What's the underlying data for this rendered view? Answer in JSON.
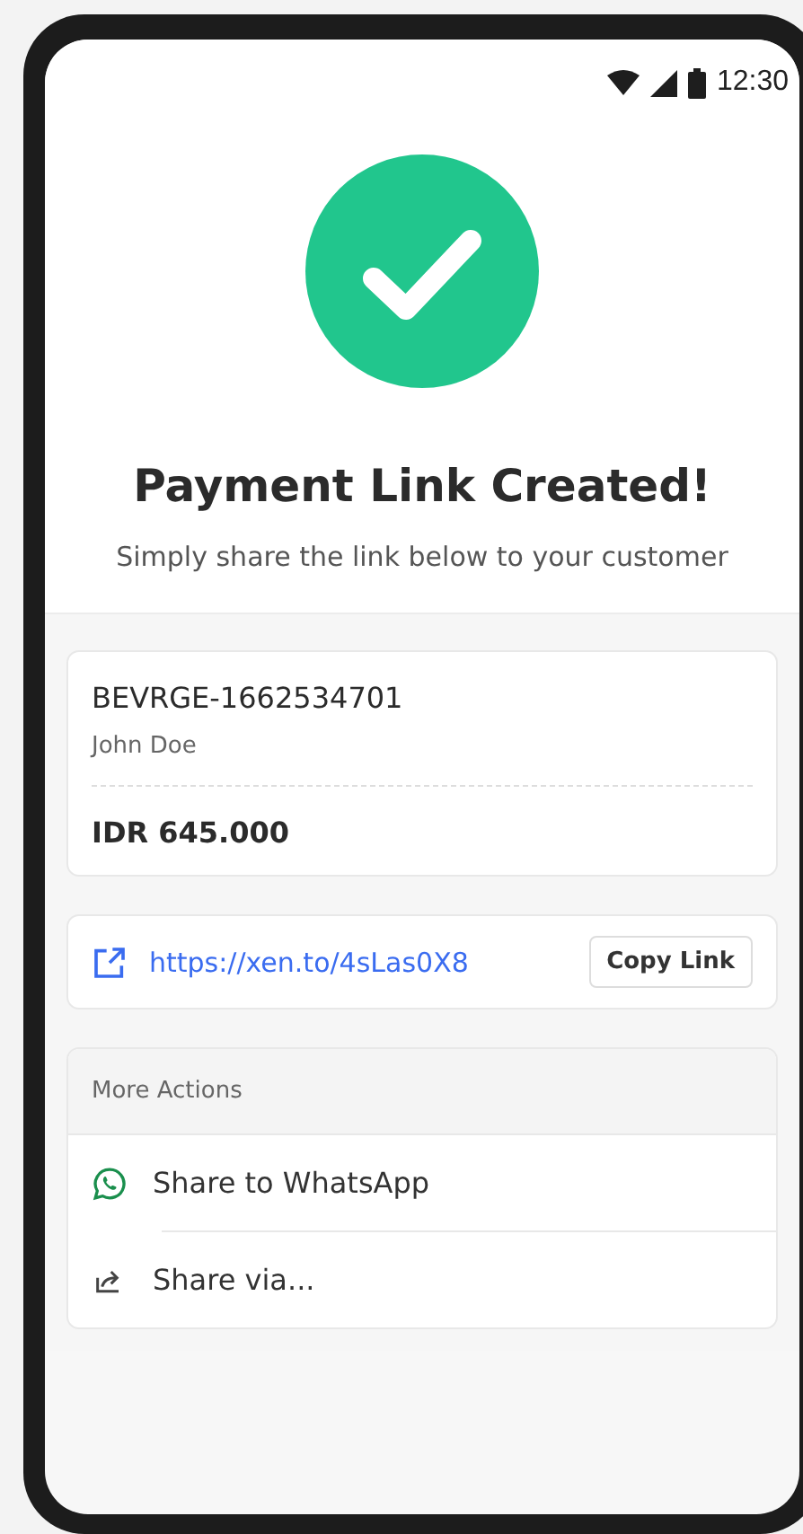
{
  "status_bar": {
    "time": "12:30"
  },
  "header": {
    "title": "Payment Link Created!",
    "subtitle": "Simply share the link below to your customer"
  },
  "invoice": {
    "reference": "BEVRGE-1662534701",
    "customer": "John Doe",
    "amount": "IDR 645.000"
  },
  "link": {
    "url": "https://xen.to/4sLas0X8",
    "copy_button": "Copy Link"
  },
  "more_actions": {
    "title": "More Actions",
    "items": [
      {
        "kind": "whatsapp",
        "label": "Share to WhatsApp"
      },
      {
        "kind": "share",
        "label": "Share via..."
      }
    ]
  }
}
